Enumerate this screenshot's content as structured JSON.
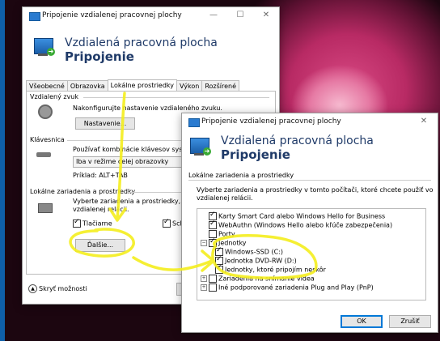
{
  "dialog1": {
    "title": "Pripojenie vzdialenej pracovnej plochy",
    "header_line1": "Vzdialená pracovná plocha",
    "header_line2": "Pripojenie",
    "tabs": [
      {
        "label": "Všeobecné",
        "active": false
      },
      {
        "label": "Obrazovka",
        "active": false
      },
      {
        "label": "Lokálne prostriedky",
        "active": true
      },
      {
        "label": "Výkon",
        "active": false
      },
      {
        "label": "Rozšírené",
        "active": false
      }
    ],
    "remote_audio": {
      "group": "Vzdialený zvuk",
      "desc": "Nakonfigurujte nastavenie vzdialeného zvuku.",
      "button": "Nastavenie..."
    },
    "keyboard": {
      "group": "Klávesnica",
      "desc": "Používať kombinácie klávesov systém",
      "select_value": "Iba v režime celej obrazovky",
      "example": "Príklad: ALT+TAB"
    },
    "local_devices": {
      "group": "Lokálne zariadenia a prostriedky",
      "desc_line1": "Vyberte zariadenia a prostriedky, ktoré",
      "desc_line2": "vzdialenej relácii.",
      "printers": "Tlačiarne",
      "clipboard": "Sch",
      "more_button": "Ďalšie..."
    },
    "hide_options": "Skryť možnosti"
  },
  "dialog2": {
    "title": "Pripojenie vzdialenej pracovnej plochy",
    "header_line1": "Vzdialená pracovná plocha",
    "header_line2": "Pripojenie",
    "group": "Lokálne zariadenia a prostriedky",
    "desc_line1": "Vyberte zariadenia a prostriedky v tomto počítači, ktoré chcete použiť vo",
    "desc_line2": "vzdialenej relácii.",
    "tree": [
      {
        "label": "Karty Smart Card alebo Windows Hello for Business",
        "checked": true,
        "indent": 0,
        "expander": ""
      },
      {
        "label": "WebAuthn (Windows Hello alebo kľúče zabezpečenia)",
        "checked": true,
        "indent": 0,
        "expander": ""
      },
      {
        "label": "Porty",
        "checked": false,
        "indent": 0,
        "expander": ""
      },
      {
        "label": "Jednotky",
        "checked": true,
        "indent": 0,
        "expander": "−"
      },
      {
        "label": "Windows-SSD (C:)",
        "checked": true,
        "indent": 1,
        "expander": ""
      },
      {
        "label": "Jednotka DVD-RW (D:)",
        "checked": true,
        "indent": 1,
        "expander": ""
      },
      {
        "label": "Jednotky, ktoré pripojím neskôr",
        "checked": true,
        "indent": 1,
        "expander": ""
      },
      {
        "label": "Zariadenia na snímanie videa",
        "checked": false,
        "indent": 0,
        "expander": "+"
      },
      {
        "label": "Iné podporované zariadenia Plug and Play (PnP)",
        "checked": false,
        "indent": 0,
        "expander": "+"
      }
    ],
    "ok": "OK",
    "cancel": "Zrušiť"
  },
  "colors": {
    "accent": "#0078d7",
    "annotation": "#f4ee1e",
    "header_text": "#1f3a68"
  }
}
